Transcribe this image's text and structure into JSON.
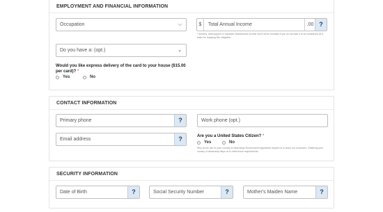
{
  "employment": {
    "title": "EMPLOYMENT AND FINANCIAL INFORMATION",
    "occupation_placeholder": "Occupation",
    "income_currency": "$",
    "income_placeholder": "Total Annual Income",
    "income_cents": ".00",
    "income_help": "?",
    "income_note": "* Alimony, child support or separate maintenance income need not be revealed if you do not wish it to be considered as a basis for repaying this obligation.",
    "have_placeholder": "Do you have a: (opt.)",
    "express_question": "Would you like express delivery of the card to your house ($15.00 per card)?",
    "required_mark": "*",
    "yes_label": "Yes",
    "no_label": "No"
  },
  "contact": {
    "title": "CONTACT INFORMATION",
    "primary_phone_placeholder": "Primary phone",
    "primary_phone_help": "?",
    "work_phone_placeholder": "Work phone (opt.)",
    "email_placeholder": "Email address",
    "email_help": "?",
    "citizen_question": "Are you a United States Citizen?",
    "required_mark": "*",
    "yes_label": "Yes",
    "no_label": "No",
    "citizen_note": "Why do we ask for your country of citizenship?Government regulations require us to know our customers. Obtaining your country of citizenship helps us to meet those requirements."
  },
  "security": {
    "title": "SECURITY INFORMATION",
    "dob_placeholder": "Date of Birth",
    "dob_help": "?",
    "ssn_placeholder": "Social Security Number",
    "ssn_help": "?",
    "maiden_placeholder": "Mother's Maiden Name",
    "maiden_help": "?"
  }
}
